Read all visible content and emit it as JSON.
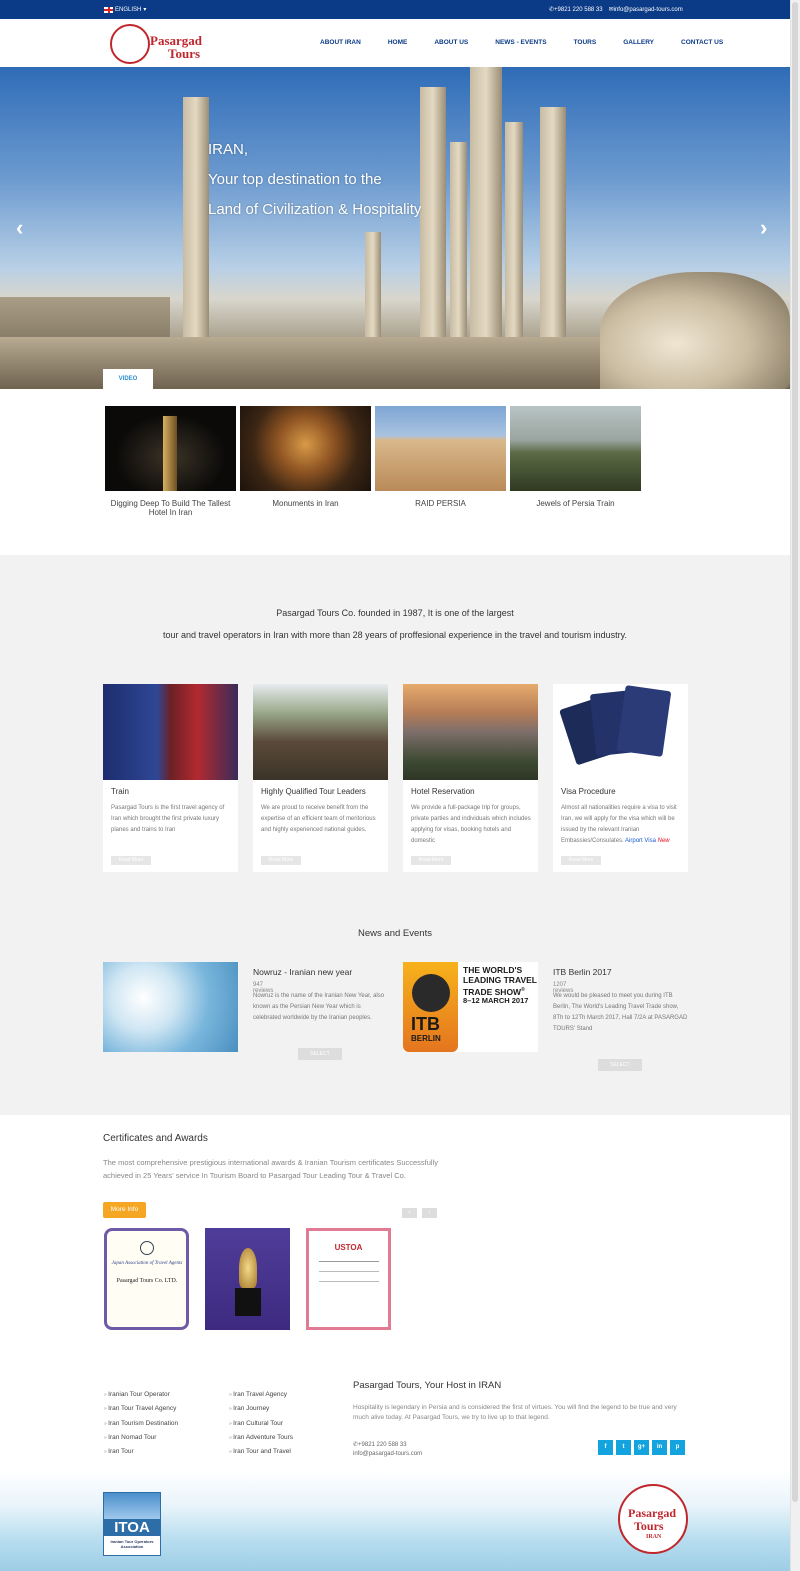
{
  "topbar": {
    "language": "ENGLISH",
    "phone": "+9821 220 588 33",
    "email": "info@pasargad-tours.com"
  },
  "header": {
    "logo_line1": "Pasargad",
    "logo_line2": "Tours",
    "nav": [
      "ABOUT IRAN",
      "HOME",
      "ABOUT US",
      "NEWS - EVENTS",
      "TOURS",
      "GALLERY",
      "CONTACT US"
    ]
  },
  "hero": {
    "line1": "IRAN,",
    "line2": "Your top destination to the",
    "line3": "Land of Civilization & Hospitality",
    "prev": "‹",
    "next": "›",
    "video_tab": "VIDEO"
  },
  "videos": [
    {
      "caption": "Digging Deep To Build The Tallest Hotel In Iran"
    },
    {
      "caption": "Monuments in Iran"
    },
    {
      "caption": "RAID PERSIA"
    },
    {
      "caption": "Jewels of Persia Train"
    }
  ],
  "intro": {
    "line1": "Pasargad Tours Co. founded in 1987, It is one of the largest",
    "line2": "tour and travel operators in Iran with more than 28 years of proffesional experience in the travel and tourism industry."
  },
  "services": [
    {
      "title": "Train",
      "desc": "Pasargad Tours is the first travel agency of Iran which brought the first private luxury planes and trains to Iran",
      "more": "Read More"
    },
    {
      "title": "Highly Qualified Tour Leaders",
      "desc": "We are proud to receive benefit from the expertise of an efficient team of meritorious and highly experienced national guides.",
      "more": "Read More"
    },
    {
      "title": "Hotel Reservation",
      "desc": "We provide a full-package trip for groups, private parties and individuals which includes applying for visas, booking hotels and domestic",
      "more": "Read More"
    },
    {
      "title": "Visa Procedure",
      "desc": "Almost all nationalities require a visa to visit Iran, we will apply for the visa which will be issued by the relevant Iranian Embassies/Consulates.",
      "airport": "Airport Visa",
      "new": "New",
      "more": "Read More"
    }
  ],
  "news": {
    "title": "News and Events",
    "items": [
      {
        "title": "Nowruz - Iranian new year",
        "reviews": "947 reviews",
        "desc": "Nowruz is the name of the Iranian New Year, also known as the Persian New Year which is celebrated worldwide by the Iranian peoples.",
        "select": "SELECT"
      },
      {
        "title": "ITB Berlin 2017",
        "reviews": "1207 reviews",
        "desc": "We would be pleased to meet you during ITB Berlin, The World's Leading Travel Trade show, 8Th to 12Th March 2017, Hall 7/2A at PASARGAD TOURS' Stand",
        "select": "SELECT",
        "logo_text": "ITB",
        "logo_sub": "BERLIN",
        "headline": "THE WORLD'S LEADING TRAVEL TRADE SHOW",
        "registered": "®",
        "dates": "8–12 MARCH 2017"
      }
    ]
  },
  "certificates": {
    "title": "Certificates and Awards",
    "desc": "The most comprehensive prestigious international awards & Iranian Tourism certificates Successfully achieved in 25 Years' service In Tourism Board to Pasargad Tour Leading Tour & Travel Co.",
    "more": "More Info",
    "cert1_org": "Japan Association of Travel Agents",
    "cert1_name": "Pasargad Tours Co. LTD.",
    "cert3_org": "USTOA"
  },
  "footer": {
    "col1": [
      "Iranian Tour Operator",
      "Iran Tour Travel Agency",
      "Iran Tourism Destination",
      "Iran Nomad Tour",
      "Iran Tour"
    ],
    "col2": [
      "Iran Travel Agency",
      "Iran Journey",
      "Iran Cultural Tour",
      "Iran Adventure Tours",
      "Iran Tour and Travel"
    ],
    "title": "Pasargad Tours, Your Host in IRAN",
    "desc": "Hospitality is legendary in Persia and is considered the first of virtues. You will find the legend to be true and very much alive today. At Pasargad Tours, we try to live up to that legend.",
    "phone": "+9821 220 588 33",
    "email": "info@pasargad-tours.com",
    "social": [
      "f",
      "t",
      "g+",
      "in",
      "p"
    ]
  },
  "bottom": {
    "itoa": "ITOA",
    "itoa_sub": "Iranian Tour Operators Association",
    "logo_line1": "Pasargad",
    "logo_line2": "Tours",
    "logo_line3": "IRAN"
  }
}
